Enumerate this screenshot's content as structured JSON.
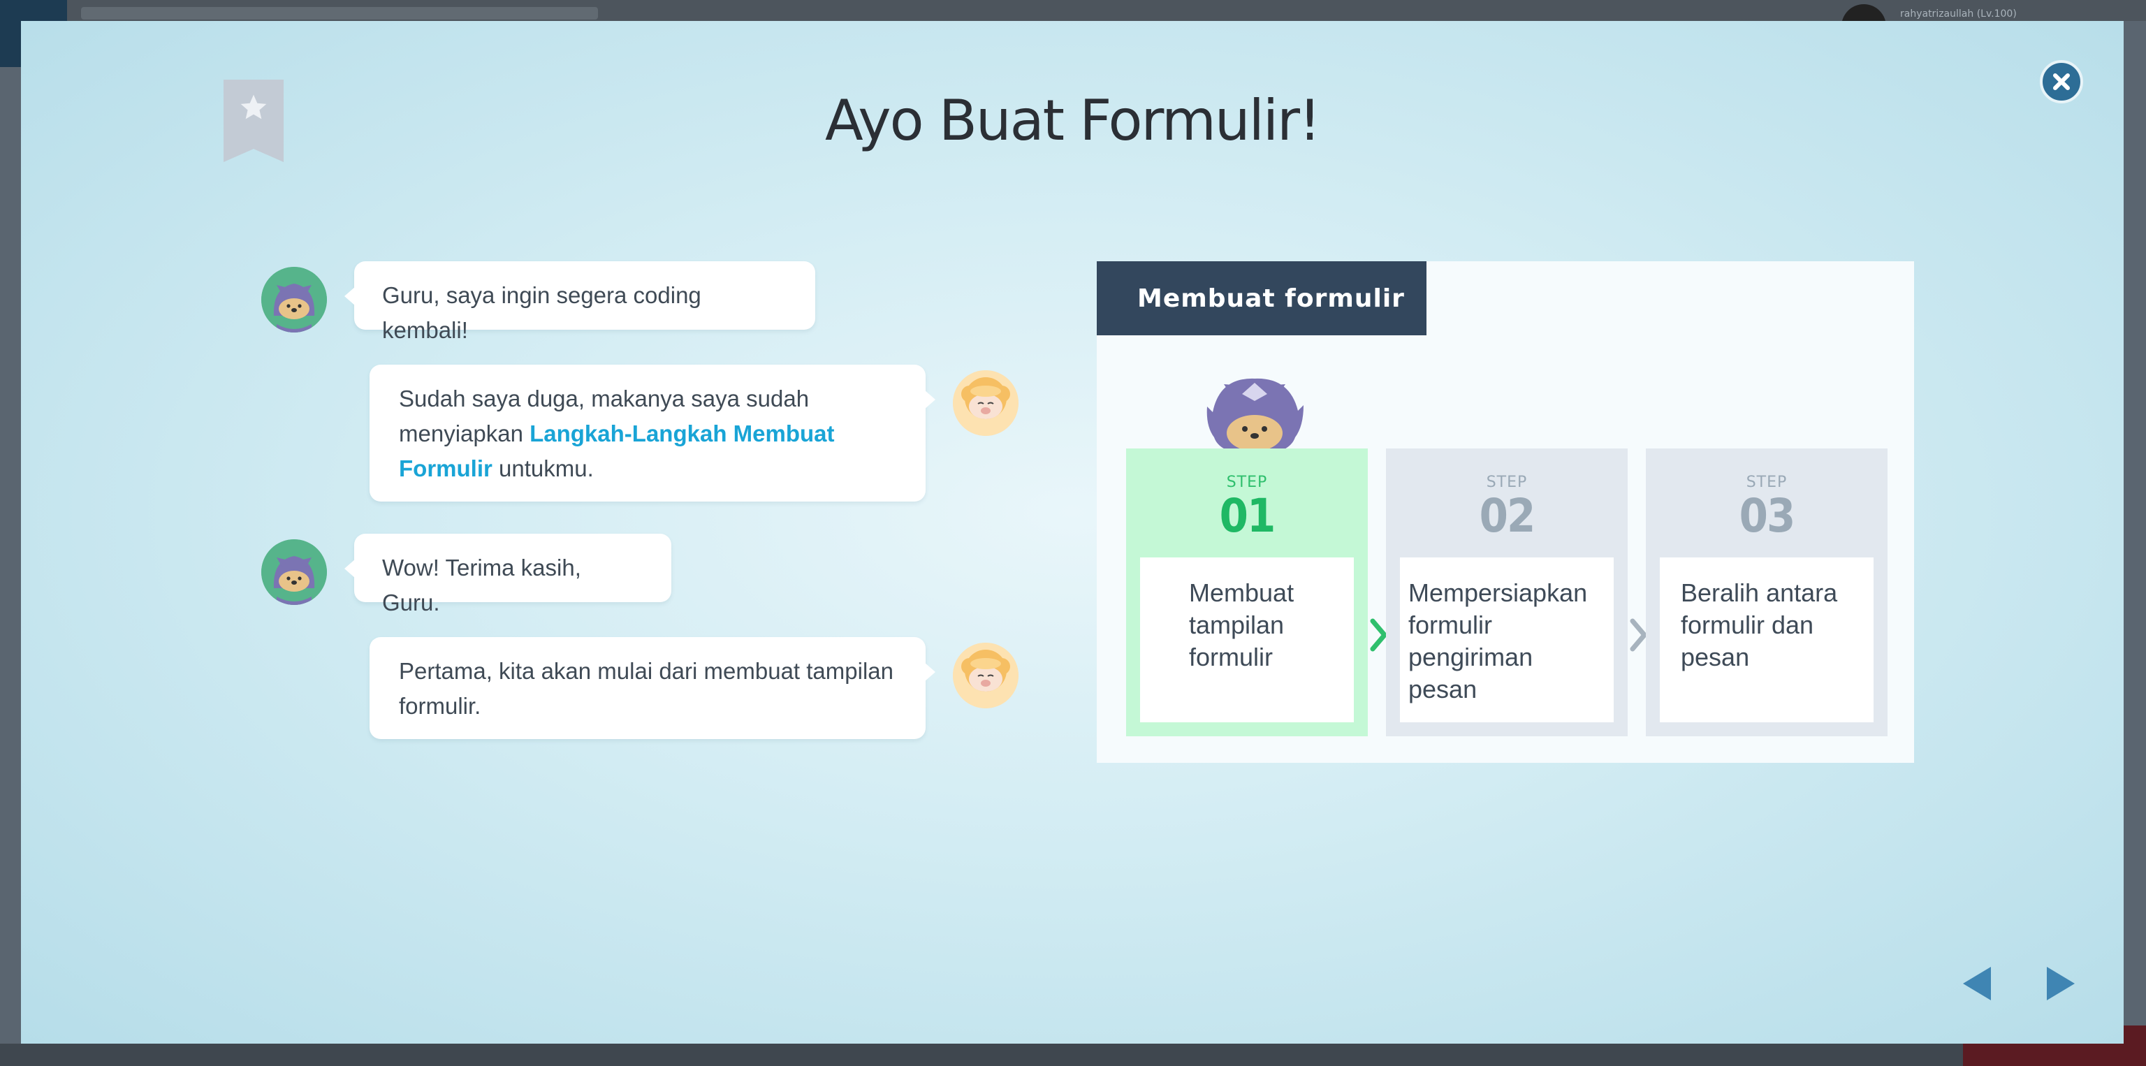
{
  "backdrop": {
    "user_label": "rahyatrizaullah (Lv.100)"
  },
  "modal": {
    "title": "Ayo Buat Formulir!",
    "bookmark_icon": "star-bookmark-icon",
    "close_icon": "close-icon"
  },
  "chat": [
    {
      "speaker": "student",
      "text": "Guru, saya ingin segera coding kembali!"
    },
    {
      "speaker": "teacher",
      "text_before": "Sudah saya duga, makanya saya sudah menyiapkan ",
      "highlight": "Langkah-Langkah Membuat Formulir",
      "text_after": " untukmu."
    },
    {
      "speaker": "student",
      "text": "Wow! Terima kasih, Guru."
    },
    {
      "speaker": "teacher",
      "text": "Pertama, kita akan mulai dari membuat tampilan formulir."
    }
  ],
  "steps_panel": {
    "header": "Membuat formulir",
    "steps": [
      {
        "label": "STEP",
        "number": "01",
        "text": "Membuat\ntampilan\nformulir",
        "active": true
      },
      {
        "label": "STEP",
        "number": "02",
        "text": "Mempersiapkan\nformulir\npengiriman\npesan",
        "active": false
      },
      {
        "label": "STEP",
        "number": "03",
        "text": "Beralih antara\nformulir dan\npesan",
        "active": false
      }
    ]
  },
  "navigation": {
    "prev_icon": "triangle-left-icon",
    "next_icon": "triangle-right-icon"
  },
  "colors": {
    "highlight": "#19a4d6",
    "header_bg": "#33475d",
    "active_step_bg": "#c4f8d6",
    "active_step_text": "#1fb864",
    "close_button": "#2d6d96",
    "nav_arrows": "#3f85b3"
  }
}
